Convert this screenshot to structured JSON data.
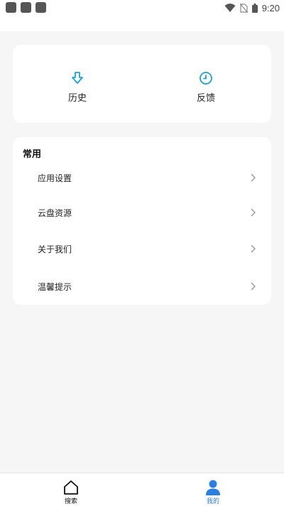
{
  "status_bar": {
    "time": "9:20",
    "icons": [
      "app-notification-icon",
      "app-notification-icon",
      "app-notification-icon",
      "wifi-icon",
      "no-sim-icon",
      "battery-icon"
    ]
  },
  "quick_actions": [
    {
      "label": "历史",
      "icon": "download-arrow-icon"
    },
    {
      "label": "反馈",
      "icon": "clock-icon"
    }
  ],
  "common": {
    "title": "常用",
    "items": [
      {
        "label": "应用设置"
      },
      {
        "label": "云盘资源"
      },
      {
        "label": "关于我们"
      },
      {
        "label": "温馨提示"
      }
    ]
  },
  "bottom_nav": {
    "items": [
      {
        "label": "搜索",
        "icon": "home-icon",
        "active": false
      },
      {
        "label": "我的",
        "icon": "user-icon",
        "active": true
      }
    ]
  },
  "colors": {
    "accent": "#1aa0e0",
    "nav_active": "#2b7fe0",
    "background": "#f6f6f6"
  }
}
